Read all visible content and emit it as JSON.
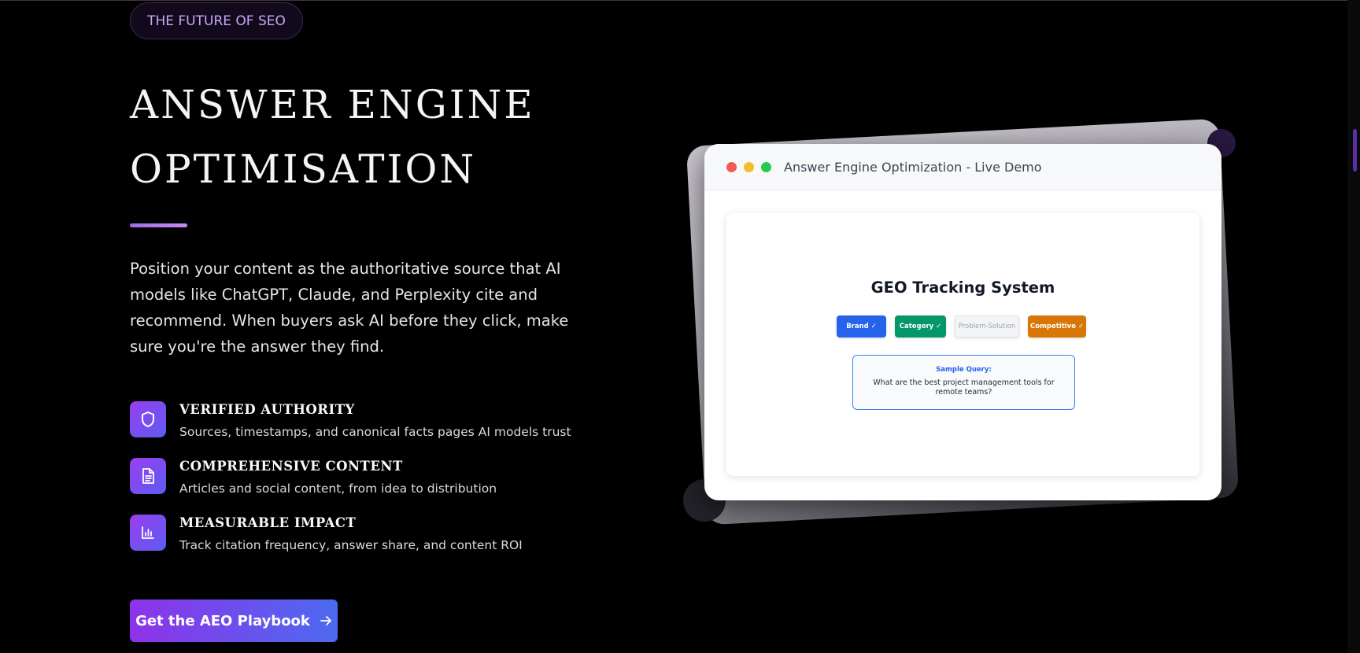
{
  "hero": {
    "badge": "THE FUTURE OF SEO",
    "headline_line1": "ANSWER ENGINE",
    "headline_line2": "OPTIMISATION",
    "intro": "Position your content as the authoritative source that AI models like ChatGPT, Claude, and Perplexity cite and recommend. When buyers ask AI before they click, make sure you're the answer they find.",
    "features": [
      {
        "title": "VERIFIED AUTHORITY",
        "desc": "Sources, timestamps, and canonical facts pages AI models trust",
        "icon": "shield-icon"
      },
      {
        "title": "COMPREHENSIVE CONTENT",
        "desc": "Articles and social content, from idea to distribution",
        "icon": "document-icon"
      },
      {
        "title": "MEASURABLE IMPACT",
        "desc": "Track citation frequency, answer share, and content ROI",
        "icon": "bar-chart-icon"
      }
    ],
    "cta_label": "Get the AEO Playbook"
  },
  "demo": {
    "window_title": "Answer Engine Optimization - Live Demo",
    "system_title": "GEO Tracking System",
    "chips": [
      {
        "label": "Brand ✓",
        "color": "#2563eb"
      },
      {
        "label": "Category ✓",
        "color": "#059669"
      },
      {
        "label": "Problem-Solution",
        "color": "#f3f4f6"
      },
      {
        "label": "Competitive ✓",
        "color": "#d97706"
      }
    ],
    "query_label": "Sample Query:",
    "query_text": "What are the best project management tools for remote teams?"
  },
  "colors": {
    "background": "#000000",
    "accent_purple": "#9b3ef0",
    "accent_blue": "#4c6af0"
  }
}
